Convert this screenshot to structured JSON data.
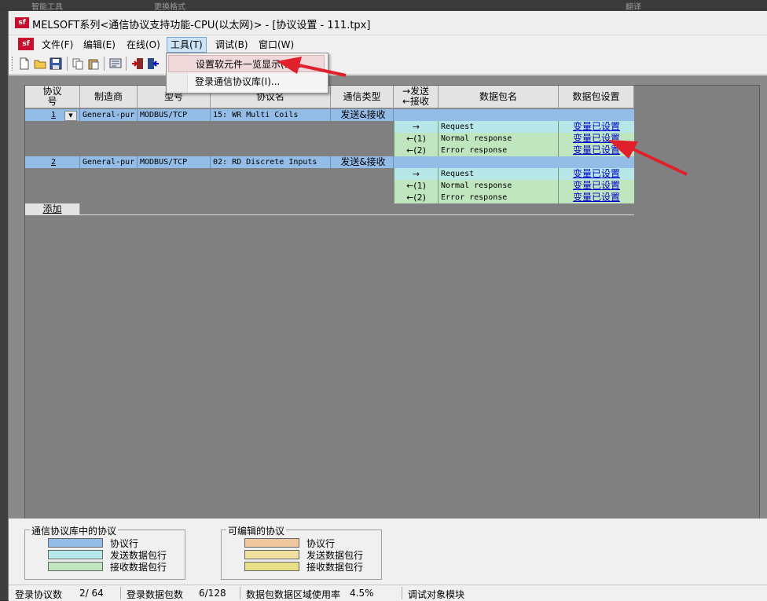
{
  "top_strip": [
    "智能工具",
    "更换格式",
    "翻译"
  ],
  "window": {
    "title": "MELSOFT系列<通信协议支持功能-CPU(以太网)> - [协议设置 - 111.tpx]",
    "logo": "sf"
  },
  "menu": {
    "file": "文件(F)",
    "edit": "编辑(E)",
    "online": "在线(O)",
    "tools": "工具(T)",
    "debug": "调试(B)",
    "window": "窗口(W)"
  },
  "tools_menu": {
    "items": [
      "设置软元件一览显示(D)...",
      "登录通信协议库(I)..."
    ]
  },
  "table": {
    "headers": {
      "no": "协议\n号",
      "maker": "制造商",
      "model": "型号",
      "name": "协议名",
      "type": "通信类型",
      "dir_send": "→发送",
      "dir_recv": "←接收",
      "packet_name": "数据包名",
      "packet_setting": "数据包设置"
    },
    "protocols": [
      {
        "no": "1",
        "maker": "General-pur",
        "model": "MODBUS/TCP",
        "name": "15: WR Multi Coils",
        "type": "发送&接收",
        "packets": [
          {
            "dir": "→",
            "name": "Request",
            "setting": "变量已设置",
            "kind": "send"
          },
          {
            "dir": "←(1)",
            "name": "Normal response",
            "setting": "变量已设置",
            "kind": "recv"
          },
          {
            "dir": "←(2)",
            "name": "Error response",
            "setting": "变量已设置",
            "kind": "recv"
          }
        ]
      },
      {
        "no": "2",
        "maker": "General-pur",
        "model": "MODBUS/TCP",
        "name": "02: RD Discrete Inputs",
        "type": "发送&接收",
        "packets": [
          {
            "dir": "→",
            "name": "Request",
            "setting": "变量已设置",
            "kind": "send"
          },
          {
            "dir": "←(1)",
            "name": "Normal response",
            "setting": "变量已设置",
            "kind": "recv"
          },
          {
            "dir": "←(2)",
            "name": "Error response",
            "setting": "变量已设置",
            "kind": "recv"
          }
        ]
      }
    ],
    "add_label": "添加"
  },
  "legend": {
    "library": {
      "title": "通信协议库中的协议",
      "items": [
        {
          "label": "协议行",
          "color": "#93bde6"
        },
        {
          "label": "发送数据包行",
          "color": "#b7e7e8"
        },
        {
          "label": "接收数据包行",
          "color": "#bfe6bf"
        }
      ]
    },
    "editable": {
      "title": "可编辑的协议",
      "items": [
        {
          "label": "协议行",
          "color": "#f0c8a0"
        },
        {
          "label": "发送数据包行",
          "color": "#f0e0a0"
        },
        {
          "label": "接收数据包行",
          "color": "#e8e088"
        }
      ]
    }
  },
  "status": {
    "protocols_label": "登录协议数",
    "protocols_value": "2/ 64",
    "packets_label": "登录数据包数",
    "packets_value": "6/128",
    "usage_label": "数据包数据区域使用率",
    "usage_value": "4.5%",
    "target_label": "调试对象模块"
  },
  "colors": {
    "annotation_arrow": "#e0202a",
    "protocol_row": "#93bde6"
  }
}
